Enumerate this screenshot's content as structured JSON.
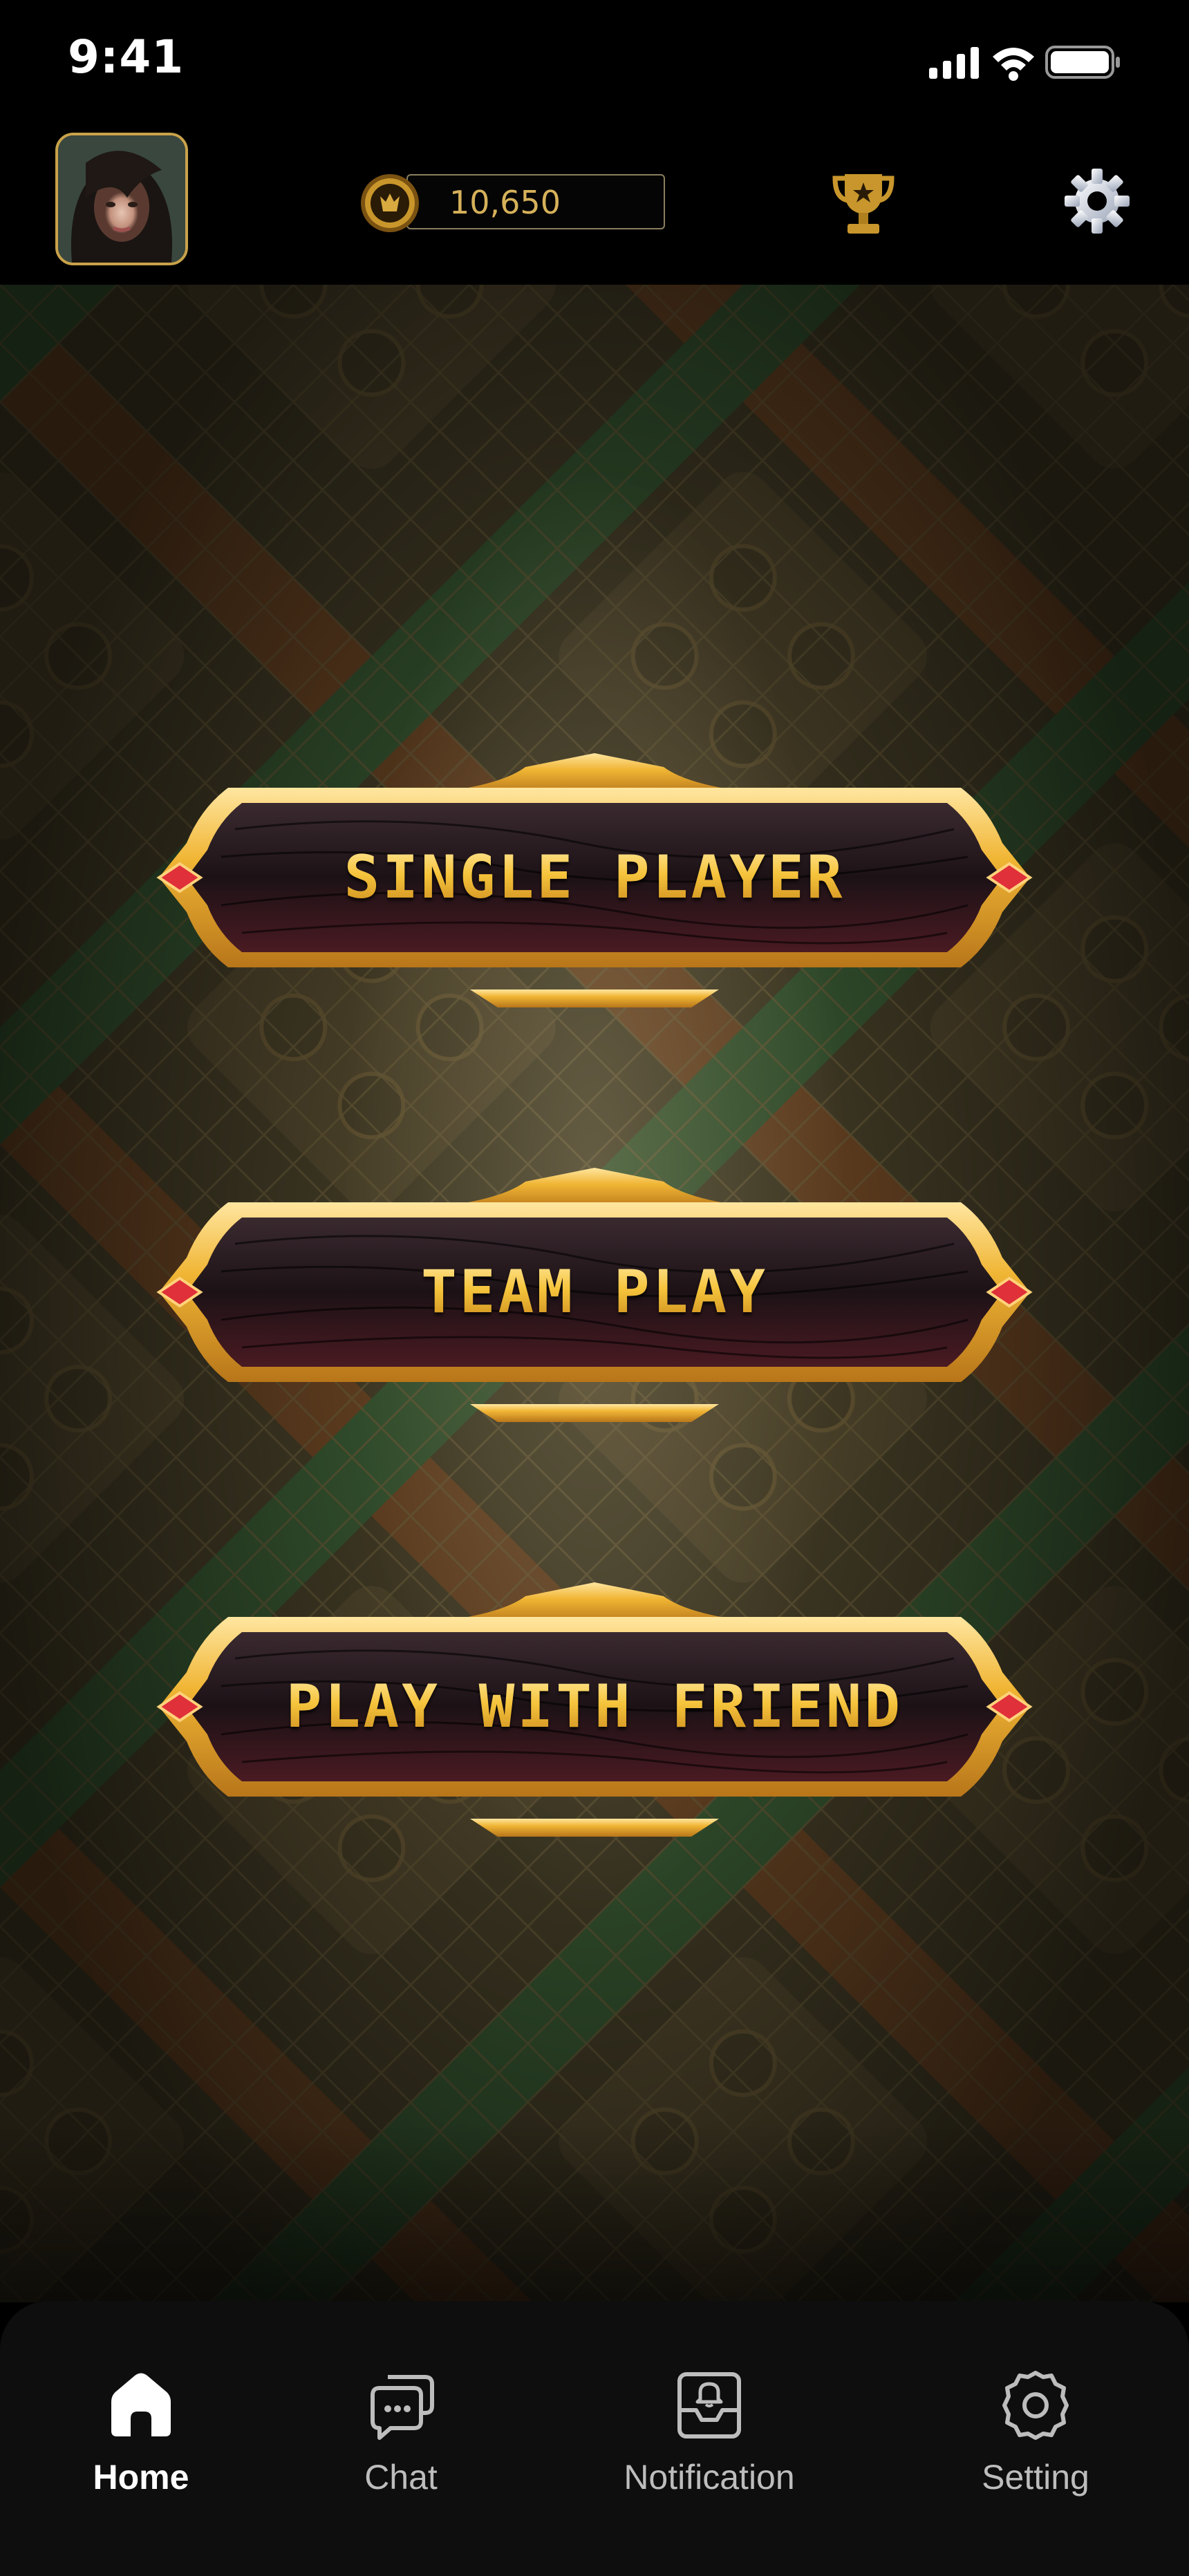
{
  "status_bar": {
    "time": "9:41"
  },
  "header": {
    "coins": "10,650"
  },
  "menu": [
    {
      "label": "SINGLE PLAYER"
    },
    {
      "label": "TEAM PLAY"
    },
    {
      "label": "PLAY WITH FRIEND"
    }
  ],
  "nav": {
    "items": [
      {
        "label": "Home",
        "icon": "home-icon",
        "active": true
      },
      {
        "label": "Chat",
        "icon": "chat-icon",
        "active": false
      },
      {
        "label": "Notification",
        "icon": "notification-icon",
        "active": false
      },
      {
        "label": "Setting",
        "icon": "settings-icon",
        "active": false
      }
    ]
  },
  "colors": {
    "gold": "#f4c23c",
    "frame_gold": "#e3a72a",
    "panel_dark": "#2a1a1c",
    "gem_red": "#e0303a",
    "nav_bg": "#0e0e0e"
  }
}
